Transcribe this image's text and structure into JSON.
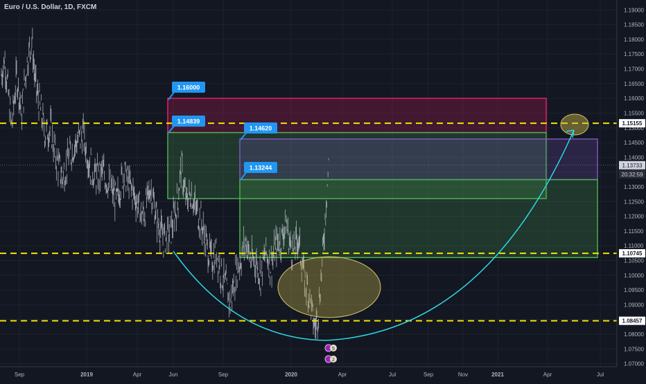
{
  "header": {
    "title": "Euro / U.S. Dollar, 1D, FXCM"
  },
  "colors": {
    "background": "#131722",
    "grid": "#1e222d",
    "candles": "#b2b5be",
    "level_line": "#f5e500",
    "curve": "#2ed7e6",
    "price_tag": "#2196f3",
    "level_tag_bg": "#ffffff",
    "last_price_tag": "#d1d4dc"
  },
  "chart_data": {
    "type": "line",
    "series": [
      {
        "values": [
          [
            0.0,
            1.168
          ],
          [
            0.01,
            1.174
          ],
          [
            0.02,
            1.162
          ],
          [
            0.03,
            1.15
          ],
          [
            0.045,
            1.168
          ],
          [
            0.06,
            1.155
          ],
          [
            0.075,
            1.172
          ],
          [
            0.09,
            1.18
          ],
          [
            0.1,
            1.165
          ],
          [
            0.115,
            1.156
          ],
          [
            0.13,
            1.148
          ],
          [
            0.145,
            1.15
          ],
          [
            0.16,
            1.14
          ],
          [
            0.18,
            1.133
          ],
          [
            0.2,
            1.14
          ],
          [
            0.22,
            1.145
          ],
          [
            0.24,
            1.148
          ],
          [
            0.26,
            1.138
          ],
          [
            0.28,
            1.133
          ],
          [
            0.3,
            1.135
          ],
          [
            0.32,
            1.13
          ],
          [
            0.34,
            1.125
          ],
          [
            0.36,
            1.135
          ],
          [
            0.38,
            1.13
          ],
          [
            0.4,
            1.125
          ],
          [
            0.42,
            1.12
          ],
          [
            0.44,
            1.13
          ],
          [
            0.46,
            1.118
          ],
          [
            0.48,
            1.112
          ],
          [
            0.5,
            1.115
          ],
          [
            0.52,
            1.125
          ],
          [
            0.53,
            1.137
          ],
          [
            0.545,
            1.125
          ],
          [
            0.56,
            1.128
          ],
          [
            0.575,
            1.122
          ],
          [
            0.59,
            1.118
          ],
          [
            0.605,
            1.11
          ],
          [
            0.62,
            1.105
          ],
          [
            0.635,
            1.108
          ],
          [
            0.65,
            1.1
          ],
          [
            0.665,
            1.095
          ],
          [
            0.675,
            1.09
          ],
          [
            0.69,
            1.1
          ],
          [
            0.705,
            1.105
          ],
          [
            0.72,
            1.112
          ],
          [
            0.735,
            1.105
          ],
          [
            0.75,
            1.105
          ],
          [
            0.765,
            1.1
          ],
          [
            0.78,
            1.108
          ],
          [
            0.795,
            1.103
          ],
          [
            0.81,
            1.11
          ],
          [
            0.825,
            1.112
          ],
          [
            0.84,
            1.118
          ],
          [
            0.85,
            1.111
          ],
          [
            0.86,
            1.108
          ],
          [
            0.875,
            1.113
          ],
          [
            0.885,
            1.105
          ],
          [
            0.895,
            1.098
          ],
          [
            0.905,
            1.095
          ],
          [
            0.915,
            1.088
          ],
          [
            0.925,
            1.082
          ],
          [
            0.935,
            1.088
          ],
          [
            0.945,
            1.102
          ],
          [
            0.955,
            1.12
          ],
          [
            0.965,
            1.1373
          ]
        ]
      }
    ],
    "xlim": [
      "Aug 2018",
      "Jul 2021"
    ],
    "x_tick_labels": [
      "Sep",
      "2019",
      "Apr",
      "Jun",
      "Sep",
      "2020",
      "Apr",
      "Jul",
      "Sep",
      "Nov",
      "2021",
      "Apr",
      "Jul"
    ],
    "y_tick_labels": [
      "1.19000",
      "1.18500",
      "1.18000",
      "1.17500",
      "1.17000",
      "1.16500",
      "1.16000",
      "1.15500",
      "1.15000",
      "1.14500",
      "1.14000",
      "1.13500",
      "1.13000",
      "1.12500",
      "1.12000",
      "1.11500",
      "1.11000",
      "1.10500",
      "1.10000",
      "1.09500",
      "1.09000",
      "1.08500",
      "1.08000",
      "1.07500",
      "1.07000"
    ],
    "ylim": [
      1.069,
      1.191
    ],
    "grid": true,
    "horizontal_levels": [
      {
        "value": 1.15155,
        "label": "1.15155"
      },
      {
        "value": 1.10745,
        "label": "1.10745"
      },
      {
        "value": 1.08457,
        "label": "1.08457"
      }
    ],
    "last_price": {
      "value": 1.13733,
      "label": "1.13733",
      "countdown": "20:32:59"
    },
    "zones": [
      {
        "name": "red-zone",
        "top": 1.16,
        "bottom": 1.14839,
        "from": "Jun 2019",
        "to": "Apr 2021",
        "color": "#e91e63"
      },
      {
        "name": "green-zone-1",
        "top": 1.14839,
        "bottom": 1.126,
        "from": "Jun 2019",
        "to": "Apr 2021",
        "color": "#4caf50"
      },
      {
        "name": "purple-zone",
        "top": 1.1462,
        "bottom": 1.13244,
        "from": "Oct 2019",
        "to": "Jul 2021",
        "color": "#7e57c2"
      },
      {
        "name": "green-zone-2",
        "top": 1.13244,
        "bottom": 1.106,
        "from": "Oct 2019",
        "to": "Jul 2021",
        "color": "#4caf50"
      }
    ],
    "price_labels": [
      "1.16000",
      "1.14839",
      "1.14620",
      "1.13244"
    ],
    "badges": [
      "5",
      "2"
    ]
  }
}
